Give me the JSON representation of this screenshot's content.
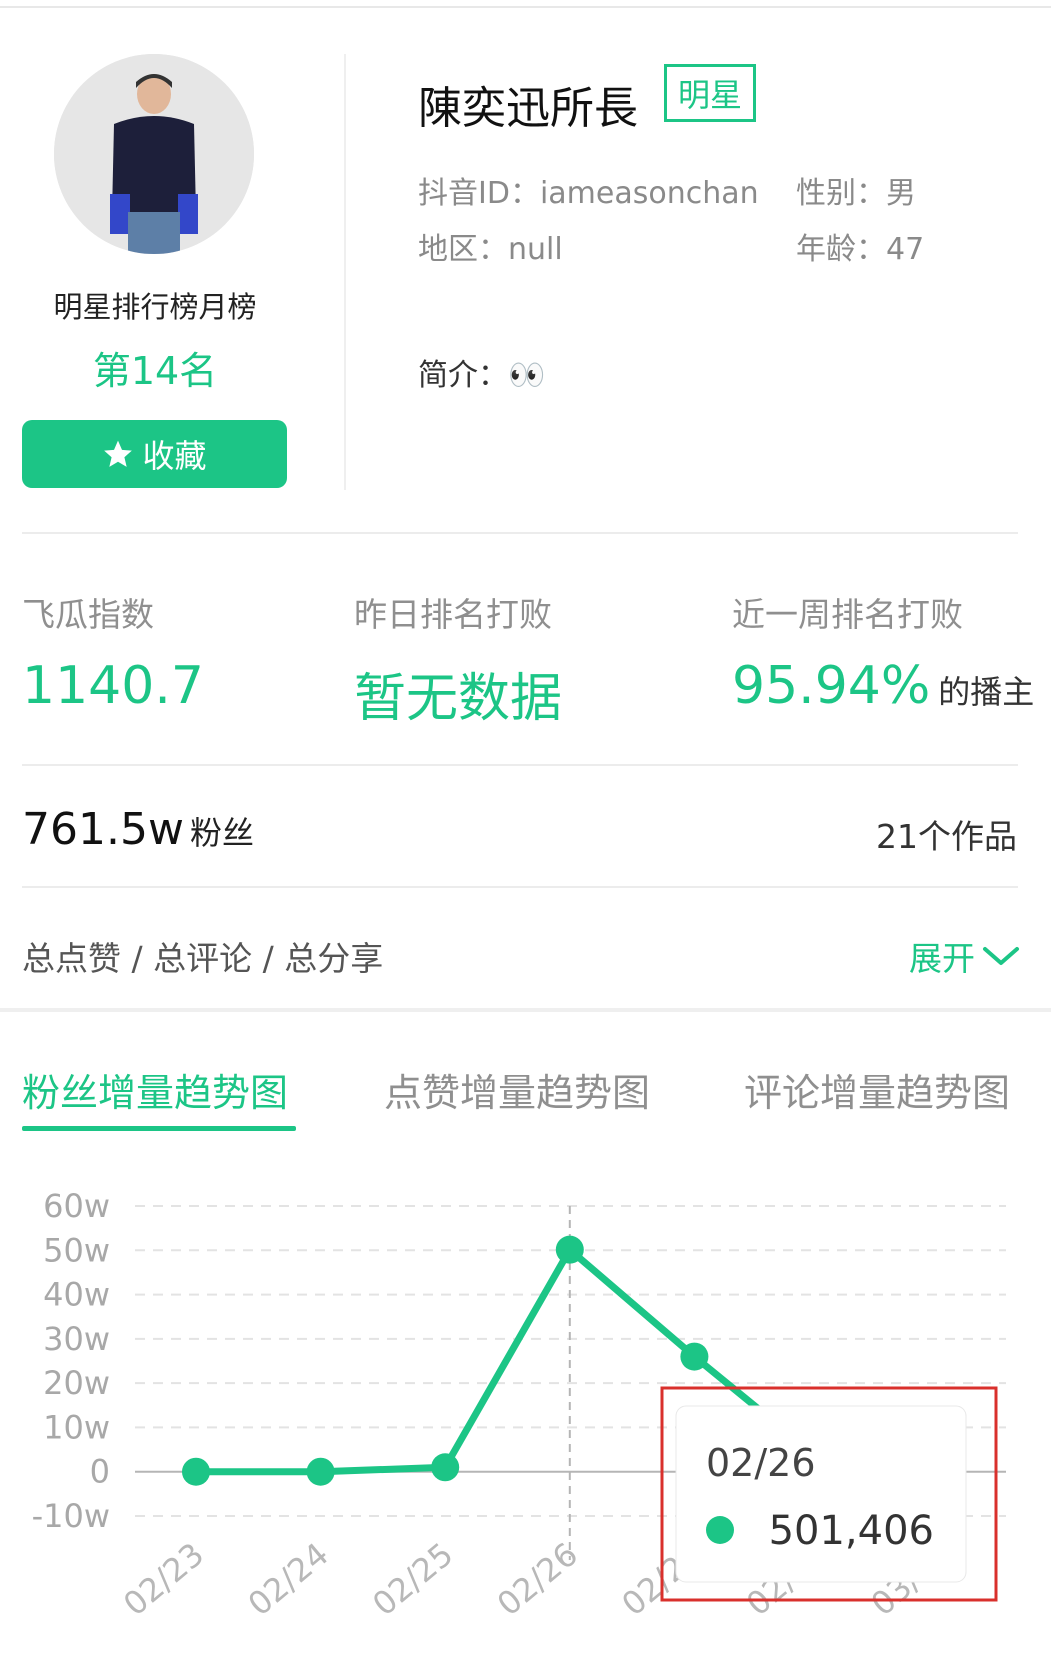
{
  "profile": {
    "name": "陳奕迅所長",
    "tag": "明星",
    "douyin_id": "抖音ID：iameasonchan",
    "gender": "性别：男",
    "region": "地区：null",
    "age": "年龄：47",
    "intro_label": "简介：",
    "intro_emoji": "👀",
    "rank_label": "明星排行榜月榜",
    "rank_value": "第14名",
    "fav_label": "收藏"
  },
  "stats": [
    {
      "label": "飞瓜指数",
      "value": "1140.7",
      "suffix": ""
    },
    {
      "label": "昨日排名打败",
      "value": "暂无数据",
      "suffix": ""
    },
    {
      "label": "近一周排名打败",
      "value": "95.94%",
      "suffix": "的播主"
    }
  ],
  "fans": {
    "value": "761.5w",
    "label": "粉丝",
    "works": "21个作品"
  },
  "totals": {
    "label": "总点赞 / 总评论 / 总分享",
    "expand": "展开"
  },
  "tabs": [
    {
      "label": "粉丝增量趋势图",
      "active": true
    },
    {
      "label": "点赞增量趋势图",
      "active": false
    },
    {
      "label": "评论增量趋势图",
      "active": false
    }
  ],
  "colors": {
    "accent": "#1cc586",
    "highlight_box": "#d9302c"
  },
  "chart_data": {
    "type": "line",
    "x": [
      "02/23",
      "02/24",
      "02/25",
      "02/26",
      "02/27",
      "02/28",
      "03/01"
    ],
    "series": [
      {
        "values": [
          0,
          0,
          10000,
          501406,
          260000,
          30000,
          null
        ]
      }
    ],
    "y_ticks": [
      "60w",
      "50w",
      "40w",
      "30w",
      "20w",
      "10w",
      "0",
      "-10w"
    ],
    "ylim": [
      -100000,
      600000
    ],
    "grid": true,
    "tooltip": {
      "date": "02/26",
      "value": "501,406"
    }
  }
}
